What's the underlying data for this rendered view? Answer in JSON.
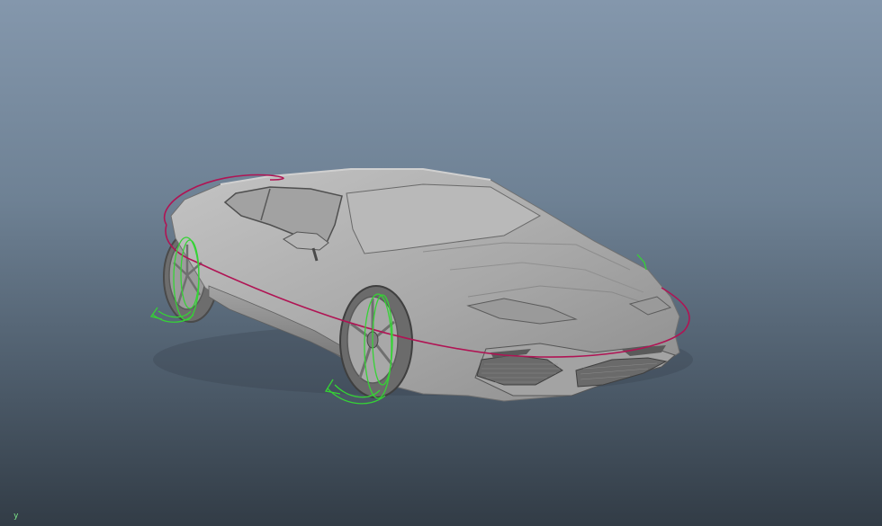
{
  "viewport": {
    "background_top": "#8497ac",
    "background_bottom": "#323c46",
    "model_color": "#b3b3b3",
    "rig_main_color": "#b01454",
    "rig_wheel_color": "#35d335"
  },
  "axis_gizmo": {
    "y_label": "y"
  }
}
